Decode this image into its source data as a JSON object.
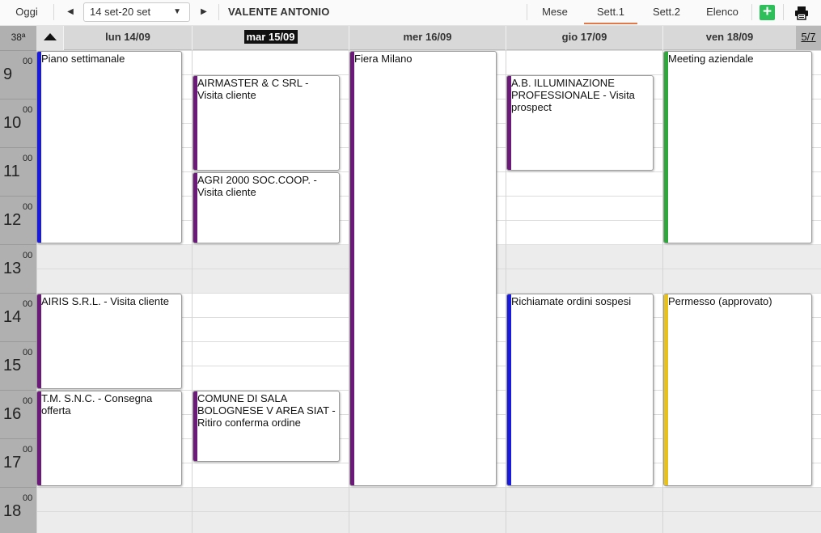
{
  "toolbar": {
    "today_label": "Oggi",
    "range_label": "14 set-20 set",
    "user_name": "VALENTE ANTONIO",
    "tabs": [
      "Mese",
      "Sett.1",
      "Sett.2",
      "Elenco"
    ],
    "active_tab": "Sett.1",
    "add_icon": "plus-icon",
    "print_icon": "printer-icon",
    "accent_color": "#e0784a"
  },
  "header": {
    "week_number": "38ª",
    "days": [
      "lun 14/09",
      "mar 15/09",
      "mer 16/09",
      "gio 17/09",
      "ven 18/09"
    ],
    "today_index": 1,
    "page_indicator": "5/7"
  },
  "hours": [
    {
      "h": "9",
      "m": "00"
    },
    {
      "h": "10",
      "m": "00"
    },
    {
      "h": "11",
      "m": "00"
    },
    {
      "h": "12",
      "m": "00"
    },
    {
      "h": "13",
      "m": "00"
    },
    {
      "h": "14",
      "m": "00"
    },
    {
      "h": "15",
      "m": "00"
    },
    {
      "h": "16",
      "m": "00"
    },
    {
      "h": "17",
      "m": "00"
    },
    {
      "h": "18",
      "m": "00"
    }
  ],
  "events": [
    {
      "day": 0,
      "start": "9:00",
      "end": "13:00",
      "title": "Piano settimanale",
      "color": "#1a1adb"
    },
    {
      "day": 0,
      "start": "14:00",
      "end": "16:00",
      "title": "AIRIS S.R.L. - Visita cliente",
      "color": "#6b1a7a"
    },
    {
      "day": 0,
      "start": "16:00",
      "end": "18:00",
      "title": "T.M. S.N.C. - Consegna offerta",
      "color": "#6b1a7a"
    },
    {
      "day": 1,
      "start": "9:30",
      "end": "11:30",
      "title": "AIRMASTER & C SRL - Visita cliente",
      "color": "#6b1a7a"
    },
    {
      "day": 1,
      "start": "11:30",
      "end": "13:00",
      "title": "AGRI 2000 SOC.COOP. - Visita cliente",
      "color": "#6b1a7a"
    },
    {
      "day": 1,
      "start": "16:00",
      "end": "17:30",
      "title": "COMUNE DI SALA BOLOGNESE V AREA SIAT - Ritiro conferma ordine",
      "color": "#6b1a7a"
    },
    {
      "day": 2,
      "start": "9:00",
      "end": "18:00",
      "title": "Fiera Milano",
      "color": "#6b1a7a"
    },
    {
      "day": 3,
      "start": "9:30",
      "end": "11:30",
      "title": "A.B. ILLUMINAZIONE PROFESSIONALE - Visita prospect",
      "color": "#6b1a7a"
    },
    {
      "day": 3,
      "start": "14:00",
      "end": "18:00",
      "title": "Richiamate ordini sospesi",
      "color": "#1a1adb"
    },
    {
      "day": 4,
      "start": "9:00",
      "end": "13:00",
      "title": "Meeting aziendale",
      "color": "#2ea83a"
    },
    {
      "day": 4,
      "start": "14:00",
      "end": "18:00",
      "title": "Permesso (approvato)",
      "color": "#e8c21a"
    }
  ]
}
